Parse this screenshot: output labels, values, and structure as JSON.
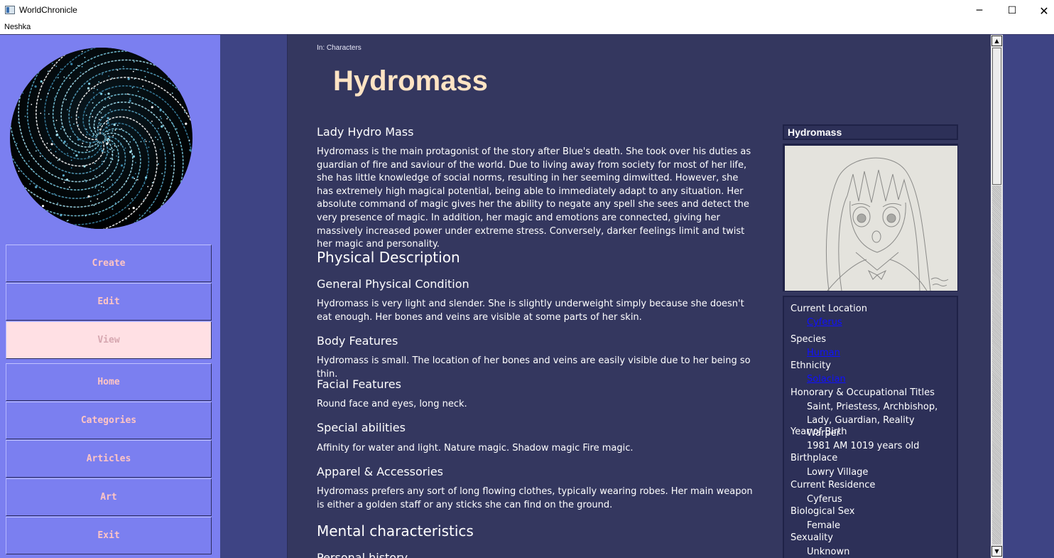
{
  "window": {
    "title": "WorldChronicle",
    "minimize_glyph": "─",
    "maximize_glyph": "☐",
    "close_glyph": "✕"
  },
  "menu": {
    "items": [
      "Neshka"
    ]
  },
  "sidebar": {
    "nav": [
      {
        "label": "Create",
        "active": false
      },
      {
        "label": "Edit",
        "active": false
      },
      {
        "label": "View",
        "active": true
      },
      {
        "label": "Home",
        "active": false
      },
      {
        "label": "Categories",
        "active": false
      },
      {
        "label": "Articles",
        "active": false
      },
      {
        "label": "Art",
        "active": false
      },
      {
        "label": "Exit",
        "active": false
      }
    ]
  },
  "article": {
    "breadcrumb": "In: Characters",
    "title": "Hydromass",
    "sections": [
      {
        "kind": "h3",
        "text": "Lady Hydro Mass"
      },
      {
        "kind": "p",
        "text": "Hydromass is the main protagonist of the story after Blue's death. She took over his duties as guardian of fire and saviour of the world. Due to living away from society for most of her life, she has little knowledge of social norms, resulting in her seeming dimwitted. However, she has extremely high magical potential, being able to immediately adapt to any situation. Her absolute command of magic gives her the ability to negate any spell she sees and detect the very presence of magic. In addition, her magic and emotions are connected, giving her massively increased power under extreme stress. Conversely, darker feelings limit and twist her magic and personality."
      },
      {
        "kind": "h2",
        "text": "Physical Description"
      },
      {
        "kind": "h3",
        "text": "General Physical Condition"
      },
      {
        "kind": "p",
        "text": "Hydromass is very light and slender. She is slightly underweight simply because she doesn't eat enough. Her bones and veins are visible at some parts of her skin."
      },
      {
        "kind": "h3",
        "text": "Body Features"
      },
      {
        "kind": "p",
        "text": "Hydromass is small. The location of her bones and veins are easily visible due to her being so thin."
      },
      {
        "kind": "h3",
        "text": "Facial Features"
      },
      {
        "kind": "p",
        "text": "Round face and eyes, long neck."
      },
      {
        "kind": "h3",
        "text": "Special abilities"
      },
      {
        "kind": "p",
        "text": "Affinity for water and light. Nature magic. Shadow magic Fire magic."
      },
      {
        "kind": "h3",
        "text": "Apparel & Accessories"
      },
      {
        "kind": "p",
        "text": "Hydromass prefers any sort of long flowing clothes, typically wearing robes. Her main weapon is either a golden staff or any sticks she can find on the ground."
      },
      {
        "kind": "h2",
        "text": "Mental characteristics"
      },
      {
        "kind": "h3",
        "text": "Personal history"
      }
    ]
  },
  "infobox": {
    "title": "Hydromass",
    "image_alt": "pencil sketch of Hydromass",
    "fields": [
      {
        "key": "Current Location",
        "value": "Cyferus",
        "link": true
      },
      {
        "key": "Species",
        "value": "Human",
        "link": true
      },
      {
        "key": "Ethnicity",
        "value": "Solacian",
        "link": true
      },
      {
        "key": "Honorary & Occupational Titles",
        "value": "Saint, Priestess, Archbishop, Lady, Guardian, Reality Warper",
        "link": false
      },
      {
        "key": "Year of Birth",
        "value": "1981 AM 1019 years old",
        "link": false
      },
      {
        "key": "Birthplace",
        "value": "Lowry Village",
        "link": false
      },
      {
        "key": "Current Residence",
        "value": "Cyferus",
        "link": false
      },
      {
        "key": "Biological Sex",
        "value": "Female",
        "link": false
      },
      {
        "key": "Sexuality",
        "value": "Unknown",
        "link": false
      }
    ]
  },
  "scrollbar": {
    "up_glyph": "▲",
    "down_glyph": "▼",
    "position": 0.0
  },
  "colors": {
    "sidebar_bg": "#7b7ff0",
    "nav_text": "#ffc4c4",
    "nav_active_bg": "#ffe0e4",
    "content_bg": "#34375f",
    "title_color": "#ffe4c4",
    "link_color": "#1010ff"
  }
}
